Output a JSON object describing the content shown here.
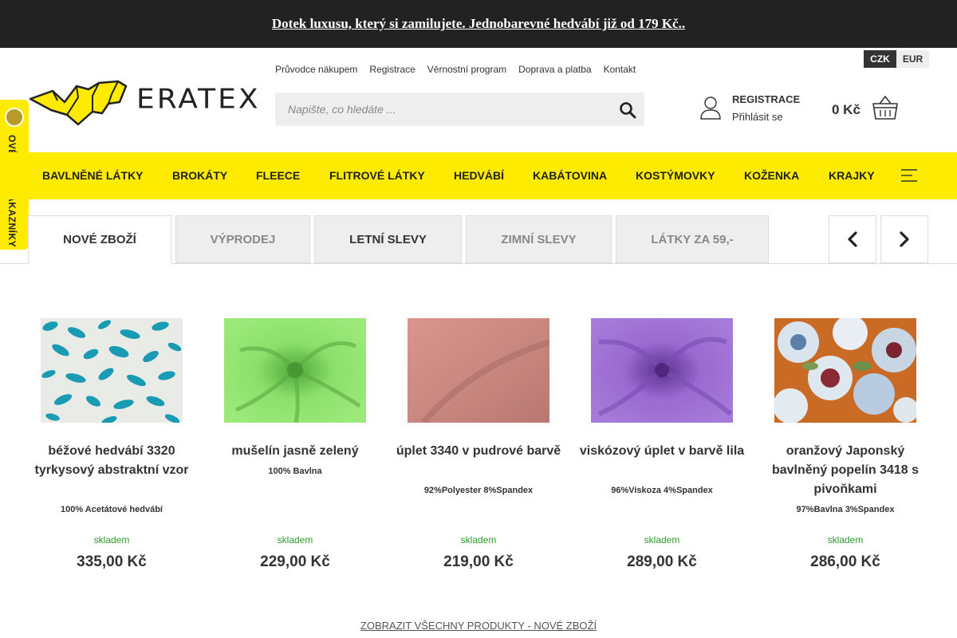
{
  "promo": {
    "text": " Dotek luxusu, který si zamilujete. Jednobarevné hedvábí již od 179 Kč.."
  },
  "currency": {
    "czk": "CZK",
    "eur": "EUR"
  },
  "logo": {
    "text": "ERATEX"
  },
  "toplinks": [
    "Průvodce nákupem",
    "Registrace",
    "Věrnostní program",
    "Doprava a platba",
    "Kontakt"
  ],
  "search": {
    "placeholder": "Napište, co hledáte ..."
  },
  "account": {
    "register": "REGISTRACE",
    "login": "Přihlásit se"
  },
  "cart": {
    "total": "0 Kč"
  },
  "verified": {
    "label": "OVĚŘENO ZÁKAZNÍKY"
  },
  "categories": [
    "BAVLNĚNÉ LÁTKY",
    "BROKÁTY",
    "FLEECE",
    "FLITROVÉ LÁTKY",
    "HEDVÁBÍ",
    "KABÁTOVINA",
    "KOSTÝMOVKY",
    "KOŽENKA",
    "KRAJKY"
  ],
  "tabs": [
    "NOVÉ ZBOŽÍ",
    "VÝPRODEJ",
    "LETNÍ SLEVY",
    "ZIMNÍ SLEVY",
    "LÁTKY ZA 59,-"
  ],
  "products": [
    {
      "name": "béžové hedvábí 3320 tyrkysový abstraktní vzor",
      "composition": "100% Acetátové hedvábí",
      "stock": "skladem",
      "price": "335,00 Kč"
    },
    {
      "name": "mušelín jasně zelený",
      "composition": "100% Bavlna",
      "stock": "skladem",
      "price": "229,00 Kč"
    },
    {
      "name": "úplet 3340 v pudrové barvě",
      "composition": "92%Polyester 8%Spandex",
      "stock": "skladem",
      "price": "219,00 Kč"
    },
    {
      "name": "viskózový úplet v barvě lila",
      "composition": "96%Viskoza 4%Spandex",
      "stock": "skladem",
      "price": "289,00 Kč"
    },
    {
      "name": "oranžový Japonský bavlněný popelín 3418 s pivoňkami",
      "composition": "97%Bavlna 3%Spandex",
      "stock": "skladem",
      "price": "286,00 Kč"
    }
  ],
  "show_all": "ZOBRAZIT VŠECHNY PRODUKTY - NOVÉ ZBOŽÍ",
  "colors": {
    "accent_yellow": "#ffeb00",
    "topbar": "#222222",
    "stock_green": "#2a9d2a"
  }
}
